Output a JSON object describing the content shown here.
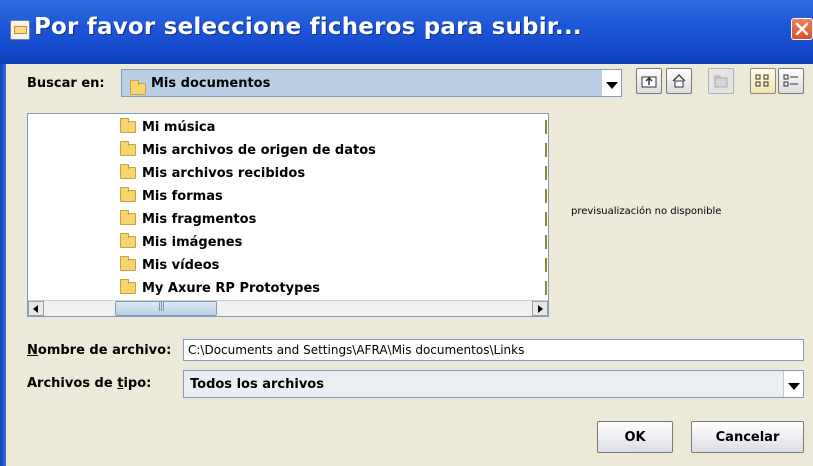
{
  "dialog": {
    "title": "Por favor seleccione ficheros para subir..."
  },
  "lookin": {
    "label": "Buscar en:",
    "value": "Mis documentos"
  },
  "toolbar": {
    "icons": [
      "up-folder-icon",
      "home-icon",
      "new-folder-icon",
      "list-view-icon",
      "details-view-icon"
    ]
  },
  "files": {
    "items": [
      {
        "label": "Mi música"
      },
      {
        "label": "Mis archivos de origen de datos"
      },
      {
        "label": "Mis archivos recibidos"
      },
      {
        "label": "Mis formas"
      },
      {
        "label": "Mis fragmentos"
      },
      {
        "label": "Mis imágenes"
      },
      {
        "label": "Mis vídeos"
      },
      {
        "label": "My Axure RP Prototypes"
      }
    ]
  },
  "preview": {
    "text": "previsualización no disponible"
  },
  "filename": {
    "label_first": "N",
    "label_rest": "ombre de archivo:",
    "value": "C:\\Documents and Settings\\AFRA\\Mis documentos\\Links"
  },
  "filetype": {
    "label_pre": "Archivos de ",
    "label_ul": "t",
    "label_post": "ipo:",
    "value": "Todos los archivos"
  },
  "buttons": {
    "ok": "OK",
    "cancel": "Cancelar"
  },
  "colors": {
    "titlebar": "#1d56d8",
    "dialog_bg": "#ece9d8",
    "combo_selected": "#b8cfe5"
  }
}
